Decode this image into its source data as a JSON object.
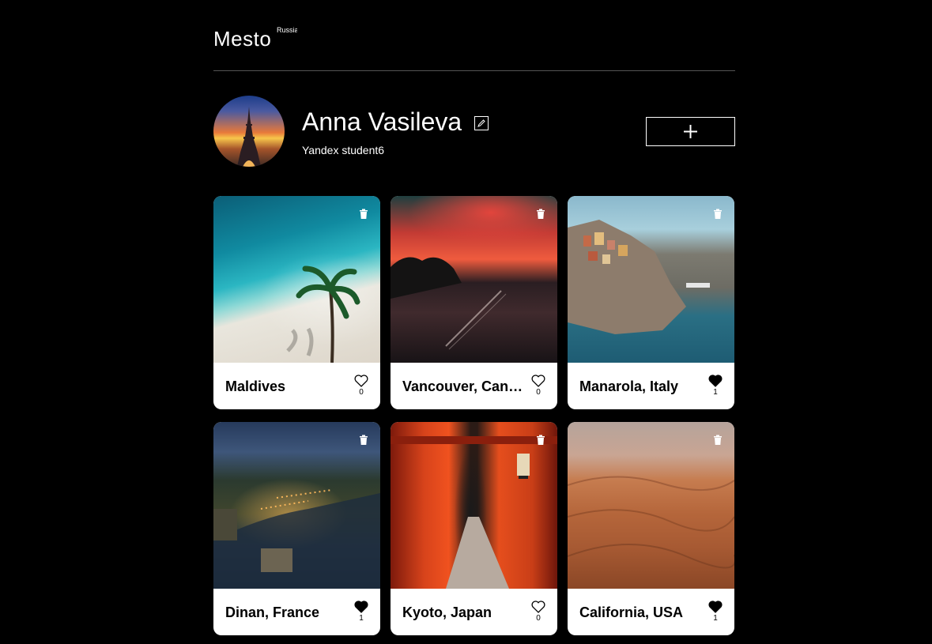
{
  "header": {
    "logo": "Mesto",
    "logo_sup": "Russia"
  },
  "profile": {
    "name": "Anna Vasileva",
    "about": "Yandex student6"
  },
  "cards": [
    {
      "title": "Maldives",
      "likes": "0",
      "liked": false
    },
    {
      "title": "Vancouver, Canada",
      "likes": "0",
      "liked": false
    },
    {
      "title": "Manarola, Italy",
      "likes": "1",
      "liked": true
    },
    {
      "title": "Dinan, France",
      "likes": "1",
      "liked": true
    },
    {
      "title": "Kyoto, Japan",
      "likes": "0",
      "liked": false
    },
    {
      "title": "California, USA",
      "likes": "1",
      "liked": true
    }
  ],
  "colors": {
    "background": "#000000",
    "card": "#ffffff",
    "divider": "#545454"
  },
  "icons": {
    "edit": "pencil-icon",
    "add": "plus-icon",
    "delete": "trash-icon",
    "like": "heart-icon"
  }
}
